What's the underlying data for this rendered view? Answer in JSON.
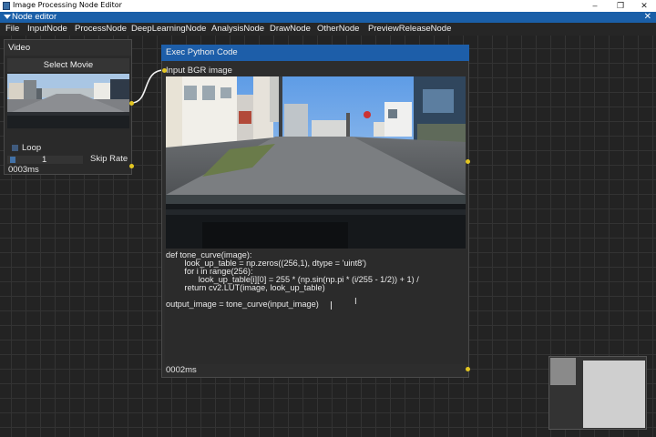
{
  "window": {
    "title": "Image Processing Node Editor",
    "minimize": "–",
    "maximize": "❐",
    "close": "✕"
  },
  "editor": {
    "title": "Node editor",
    "close": "✕"
  },
  "menu": {
    "file": "File",
    "input_node": "InputNode",
    "process_node": "ProcessNode",
    "deep_learning_node": "DeepLearningNode",
    "analysis_node": "AnalysisNode",
    "draw_node": "DrawNode",
    "other_node": "OtherNode",
    "preview_release_node": "PreviewReleaseNode"
  },
  "video_node": {
    "title": "Video",
    "select_movie": "Select Movie",
    "loop_label": "Loop",
    "loop_checked": true,
    "skip_rate_value": "1",
    "skip_rate_label": "Skip Rate",
    "elapsed": "0003ms"
  },
  "exec_node": {
    "title": "Exec Python Code",
    "input_label": "Input BGR image",
    "elapsed": "0002ms",
    "code": [
      "def tone_curve(image):",
      "        look_up_table = np.zeros((256,1), dtype = 'uint8')",
      "        for i in range(256):",
      "              look_up_table[i][0] = 255 * (np.sin(np.pi * (i/255 - 1/2)) + 1) /",
      "        return cv2.LUT(image, look_up_table)",
      "",
      "output_image = tone_curve(input_image)"
    ]
  },
  "colors": {
    "node_header": "#1d5ea9",
    "pin": "#e2c521",
    "link": "#f2f2f2"
  }
}
